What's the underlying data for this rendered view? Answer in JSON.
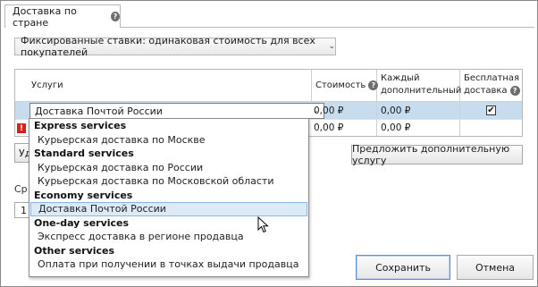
{
  "tab": {
    "label": "Доставка по стране"
  },
  "rate_type": {
    "selected": "Фиксированные ставки: одинаковая стоимость для всех покупателей"
  },
  "table": {
    "headers": {
      "services": "Услуги",
      "cost": "Стоимость",
      "each_additional_1": "Каждый",
      "each_additional_2": "дополнительный",
      "free_shipping_1": "Бесплатная",
      "free_shipping_2": "доставка"
    },
    "rows": [
      {
        "service": "Доставка Почтой России",
        "cost": "0,00 ₽",
        "each_additional": "0,00 ₽",
        "free_checked": true
      },
      {
        "service": "",
        "cost": "0,00 ₽",
        "each_additional": "0,00 ₽",
        "free_checked": false
      }
    ]
  },
  "dropdown": {
    "groups": [
      {
        "name": "Express services",
        "options": [
          "Курьерская доставка по Москве"
        ]
      },
      {
        "name": "Standard services",
        "options": [
          "Курьерская доставка по России",
          "Курьерская доставка по Московской области"
        ]
      },
      {
        "name": "Economy services",
        "options": [
          "Доставка Почтой России"
        ]
      },
      {
        "name": "One-day services",
        "options": [
          "Экспресс доставка в регионе продавца"
        ]
      },
      {
        "name": "Other services",
        "options": [
          "Оплата при получении в точках выдачи продавца"
        ]
      }
    ],
    "selected": "Доставка Почтой России"
  },
  "partial": {
    "delete_btn": "Уд",
    "label_sr": "Ср",
    "field_value": "1"
  },
  "buttons": {
    "offer_service": "Предложить дополнительную услугу",
    "save": "Сохранить",
    "cancel": "Отмена"
  },
  "icons": {
    "help": "question-icon",
    "chevron": "chevron-down-icon",
    "error": "error-icon",
    "check": "check-icon"
  },
  "colors": {
    "selected_row": "#c8dcf0",
    "error": "#d81e1e",
    "save_border": "#5b8fd6"
  }
}
